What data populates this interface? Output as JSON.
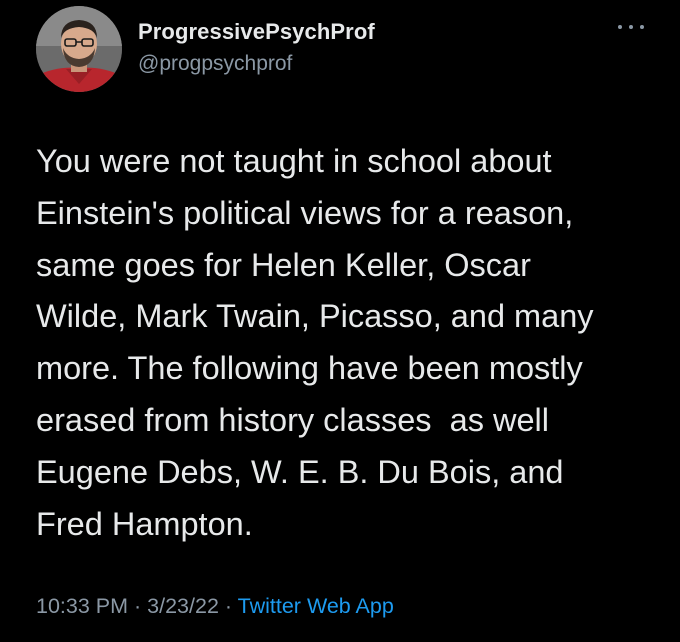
{
  "colors": {
    "background": "#000000",
    "text_primary": "#e7e9ea",
    "text_secondary": "#8b98a5",
    "link": "#1d9bf0"
  },
  "user": {
    "display_name": "ProgressivePsychProf",
    "handle": "@progpsychprof",
    "avatar_icon": "profile-photo"
  },
  "menu": {
    "icon": "more-horizontal-icon"
  },
  "tweet": {
    "text_lines": [
      "You were not taught in school about",
      "Einstein's political views for a reason,",
      "same goes for Helen Keller, Oscar",
      "Wilde, Mark Twain, Picasso, and many",
      "more. The following have been mostly",
      "erased from history classes  as well",
      "Eugene Debs, W. E. B. Du Bois, and",
      "Fred Hampton."
    ]
  },
  "meta": {
    "time": "10:33 PM",
    "separator": "·",
    "date": "3/23/22",
    "source": "Twitter Web App"
  }
}
